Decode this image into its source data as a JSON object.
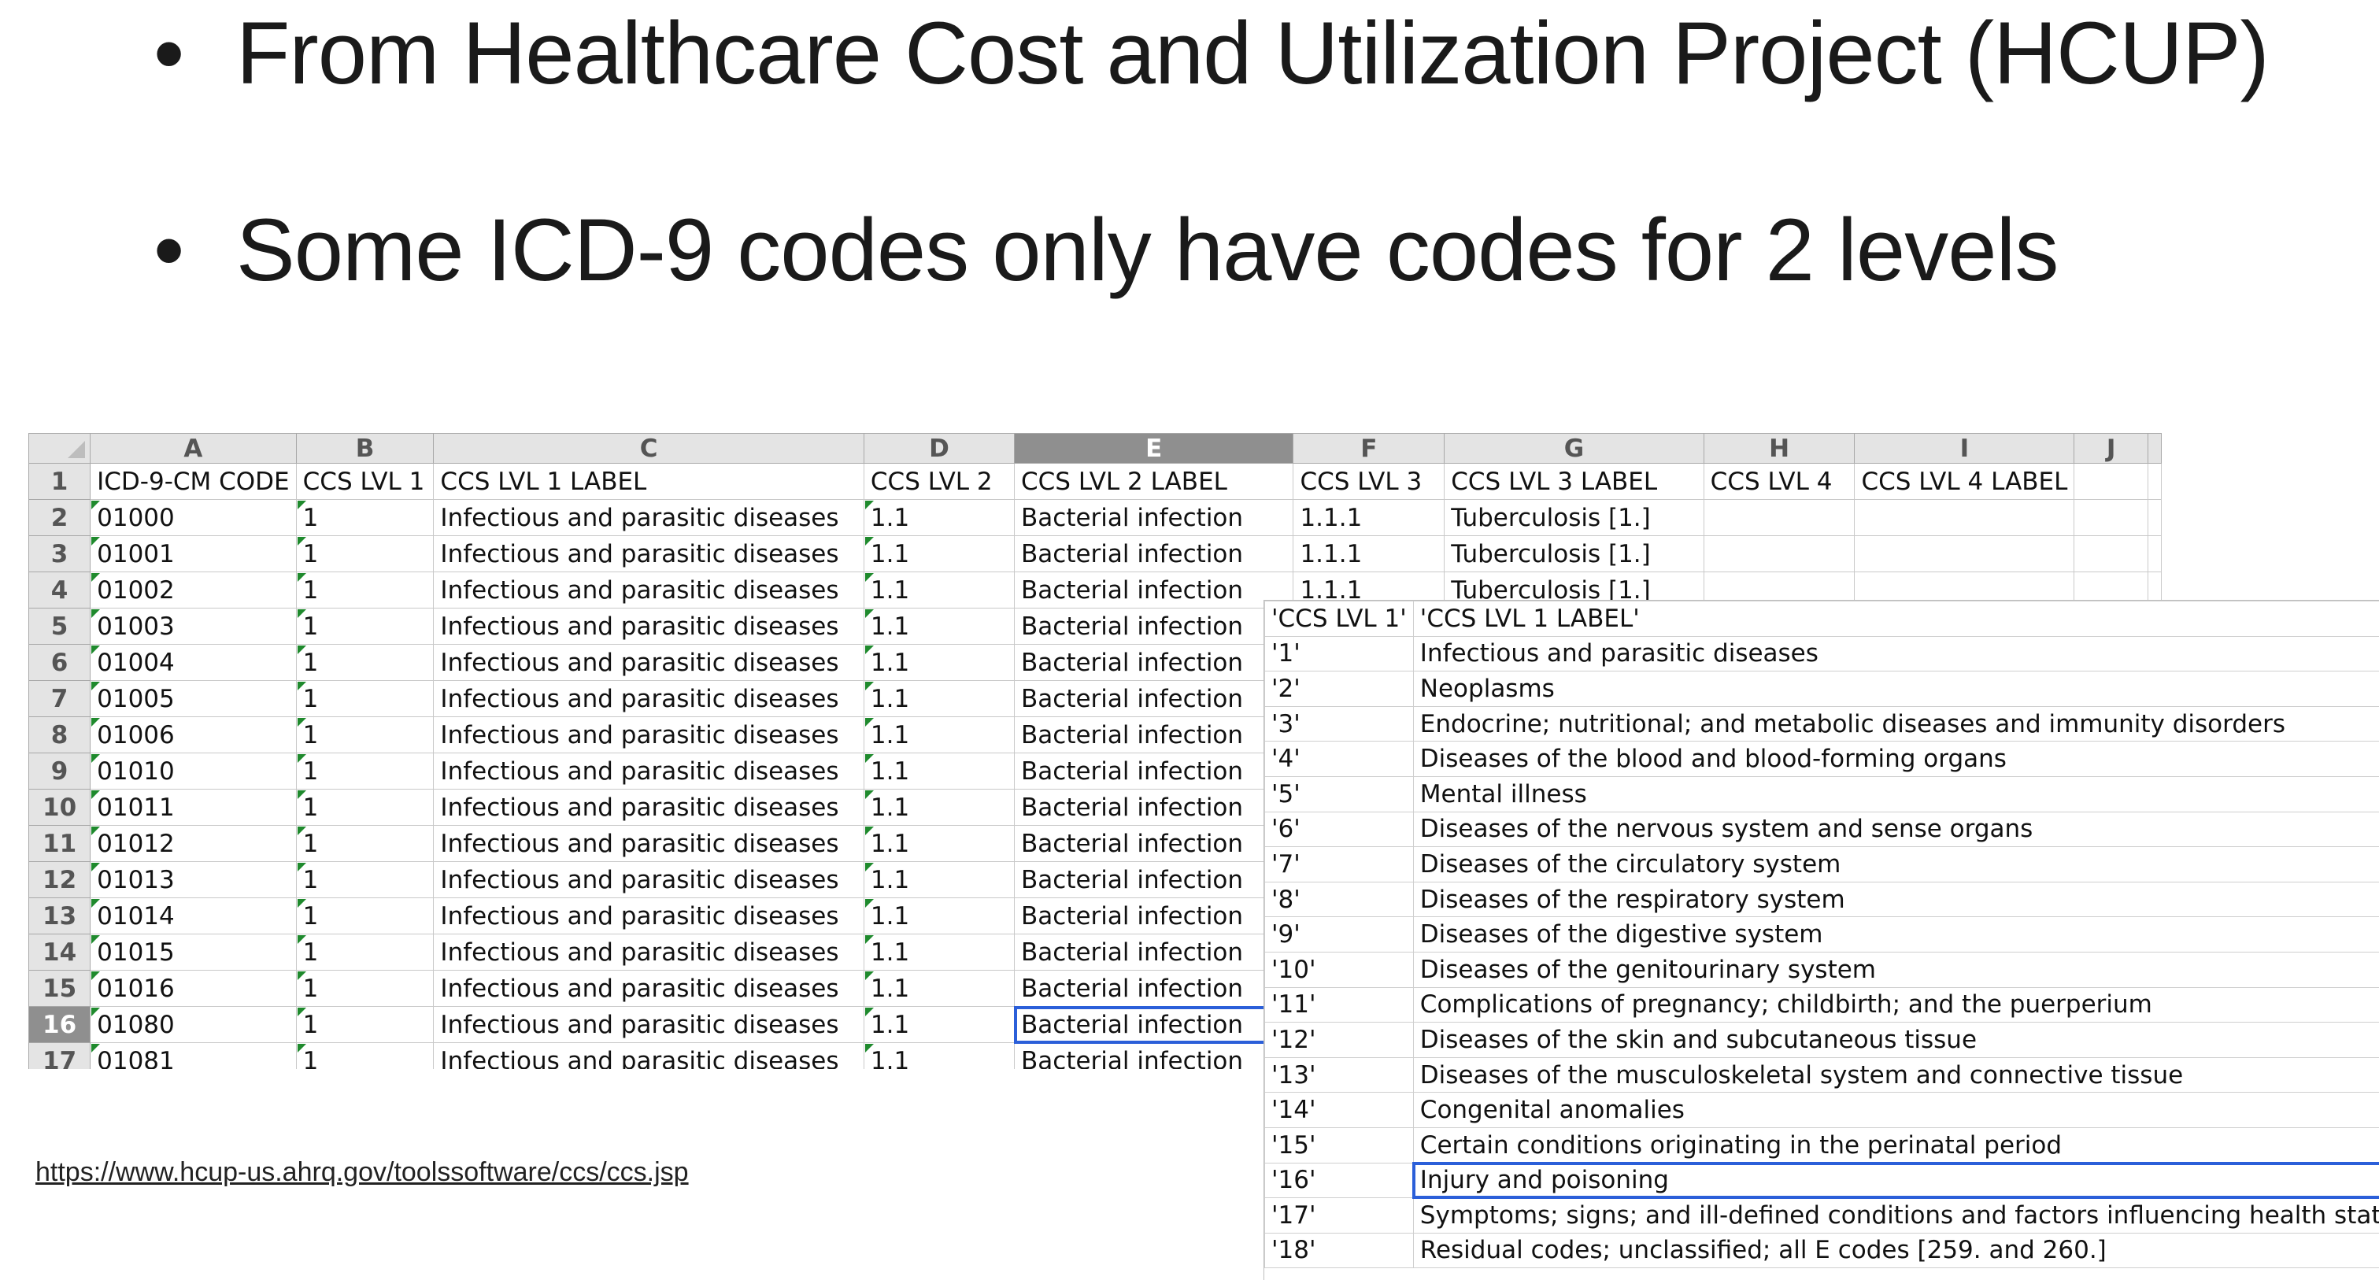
{
  "bullets": [
    {
      "symbol": "•",
      "text": "From Healthcare Cost and Utilization Project (HCUP)"
    },
    {
      "symbol": "•",
      "text": "Some ICD-9 codes only have codes for 2 levels"
    }
  ],
  "sheet": {
    "column_letters": [
      "A",
      "B",
      "C",
      "D",
      "E",
      "F",
      "G",
      "H",
      "I",
      "J"
    ],
    "selected_column": "E",
    "selected_row": "16",
    "rows": [
      {
        "n": "1",
        "cells": [
          "ICD-9-CM CODE",
          "CCS LVL 1",
          "CCS LVL 1 LABEL",
          "CCS LVL 2",
          "CCS LVL 2 LABEL",
          "CCS LVL 3",
          "CCS LVL 3 LABEL",
          "CCS LVL 4",
          "CCS LVL 4 LABEL",
          ""
        ]
      },
      {
        "n": "2",
        "cells": [
          "01000",
          "1",
          "Infectious and parasitic diseases",
          "1.1",
          "Bacterial infection",
          "1.1.1",
          "Tuberculosis [1.]",
          "",
          "",
          ""
        ]
      },
      {
        "n": "3",
        "cells": [
          "01001",
          "1",
          "Infectious and parasitic diseases",
          "1.1",
          "Bacterial infection",
          "1.1.1",
          "Tuberculosis [1.]",
          "",
          "",
          ""
        ]
      },
      {
        "n": "4",
        "cells": [
          "01002",
          "1",
          "Infectious and parasitic diseases",
          "1.1",
          "Bacterial infection",
          "1.1.1",
          "Tuberculosis [1.]",
          "",
          "",
          ""
        ]
      },
      {
        "n": "5",
        "cells": [
          "01003",
          "1",
          "Infectious and parasitic diseases",
          "1.1",
          "Bacterial infection",
          "",
          "",
          "",
          "",
          ""
        ]
      },
      {
        "n": "6",
        "cells": [
          "01004",
          "1",
          "Infectious and parasitic diseases",
          "1.1",
          "Bacterial infection",
          "",
          "",
          "",
          "",
          ""
        ]
      },
      {
        "n": "7",
        "cells": [
          "01005",
          "1",
          "Infectious and parasitic diseases",
          "1.1",
          "Bacterial infection",
          "",
          "",
          "",
          "",
          ""
        ]
      },
      {
        "n": "8",
        "cells": [
          "01006",
          "1",
          "Infectious and parasitic diseases",
          "1.1",
          "Bacterial infection",
          "",
          "",
          "",
          "",
          ""
        ]
      },
      {
        "n": "9",
        "cells": [
          "01010",
          "1",
          "Infectious and parasitic diseases",
          "1.1",
          "Bacterial infection",
          "",
          "",
          "",
          "",
          ""
        ]
      },
      {
        "n": "10",
        "cells": [
          "01011",
          "1",
          "Infectious and parasitic diseases",
          "1.1",
          "Bacterial infection",
          "",
          "",
          "",
          "",
          ""
        ]
      },
      {
        "n": "11",
        "cells": [
          "01012",
          "1",
          "Infectious and parasitic diseases",
          "1.1",
          "Bacterial infection",
          "",
          "",
          "",
          "",
          ""
        ]
      },
      {
        "n": "12",
        "cells": [
          "01013",
          "1",
          "Infectious and parasitic diseases",
          "1.1",
          "Bacterial infection",
          "",
          "",
          "",
          "",
          ""
        ]
      },
      {
        "n": "13",
        "cells": [
          "01014",
          "1",
          "Infectious and parasitic diseases",
          "1.1",
          "Bacterial infection",
          "",
          "",
          "",
          "",
          ""
        ]
      },
      {
        "n": "14",
        "cells": [
          "01015",
          "1",
          "Infectious and parasitic diseases",
          "1.1",
          "Bacterial infection",
          "",
          "",
          "",
          "",
          ""
        ]
      },
      {
        "n": "15",
        "cells": [
          "01016",
          "1",
          "Infectious and parasitic diseases",
          "1.1",
          "Bacterial infection",
          "",
          "",
          "",
          "",
          ""
        ]
      },
      {
        "n": "16",
        "cells": [
          "01080",
          "1",
          "Infectious and parasitic diseases",
          "1.1",
          "Bacterial infection",
          "",
          "",
          "",
          "",
          ""
        ]
      },
      {
        "n": "17",
        "cells": [
          "01081",
          "1",
          "Infectious and parasitic diseases",
          "1.1",
          "Bacterial infection",
          "",
          "",
          "",
          "",
          ""
        ]
      }
    ]
  },
  "lookup": {
    "header": [
      "'CCS LVL 1'",
      "'CCS LVL 1 LABEL'"
    ],
    "selected_row": "'16'",
    "rows": [
      [
        "'1'",
        "Infectious and parasitic diseases"
      ],
      [
        "'2'",
        "Neoplasms"
      ],
      [
        "'3'",
        "Endocrine; nutritional; and metabolic diseases and immunity disorders"
      ],
      [
        "'4'",
        "Diseases of the blood and blood-forming organs"
      ],
      [
        "'5'",
        "Mental illness"
      ],
      [
        "'6'",
        "Diseases of the nervous system and sense organs"
      ],
      [
        "'7'",
        "Diseases of the circulatory system"
      ],
      [
        "'8'",
        "Diseases of the respiratory system"
      ],
      [
        "'9'",
        "Diseases of the digestive system"
      ],
      [
        "'10'",
        "Diseases of the genitourinary system"
      ],
      [
        "'11'",
        "Complications of pregnancy; childbirth; and the puerperium"
      ],
      [
        "'12'",
        "Diseases of the skin and subcutaneous tissue"
      ],
      [
        "'13'",
        "Diseases of the musculoskeletal system and connective tissue"
      ],
      [
        "'14'",
        "Congenital anomalies"
      ],
      [
        "'15'",
        "Certain conditions originating in the perinatal period"
      ],
      [
        "'16'",
        "Injury and poisoning"
      ],
      [
        "'17'",
        "Symptoms; signs; and ill-defined conditions and factors influencing health status"
      ],
      [
        "'18'",
        "Residual codes; unclassified; all E codes [259. and 260.]"
      ]
    ]
  },
  "source_link": "https://www.hcup-us.ahrq.gov/toolssoftware/ccs/ccs.jsp"
}
